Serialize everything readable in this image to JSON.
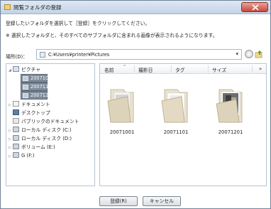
{
  "window": {
    "title": "閲覧フォルダの登録",
    "icon": "folder-icon"
  },
  "instructions": {
    "line1": "登録したいフォルダを選択して［登録］をクリックしてください。",
    "line2": "※ 選択したフォルダと、そのすべてのサブフォルダに含まれる画像が表示されるようになります。"
  },
  "location": {
    "label": "場所(D)：",
    "path": "C:¥Users¥printer¥Pictures"
  },
  "tree": {
    "items": [
      {
        "label": "ピクチャ",
        "icon": "pictures-folder-icon",
        "expander": "◢"
      },
      {
        "label": "20071001",
        "icon": "folder-icon",
        "selected": true
      },
      {
        "label": "20071101",
        "icon": "folder-icon",
        "selected": true
      },
      {
        "label": "20071201",
        "icon": "folder-icon",
        "selected": true
      },
      {
        "label": "ドキュメント",
        "icon": "documents-icon",
        "expander": "▷"
      },
      {
        "label": "デスクトップ",
        "icon": "desktop-icon"
      },
      {
        "label": "パブリックのドキュメント",
        "icon": "public-documents-icon"
      },
      {
        "label": "ローカル ディスク (C:)",
        "icon": "drive-icon",
        "expander": "▷"
      },
      {
        "label": "ローカル ディスク (D:)",
        "icon": "drive-icon",
        "expander": "▷"
      },
      {
        "label": "ボリューム (E:)",
        "icon": "drive-icon",
        "expander": "▷"
      },
      {
        "label": "G (F:)",
        "icon": "drive-icon",
        "expander": "▷"
      }
    ]
  },
  "files": {
    "columns": [
      "名前",
      "撮影日",
      "タグ",
      "サイズ"
    ],
    "more": "»",
    "sort_indicator": "^",
    "folders": [
      {
        "name": "20071001"
      },
      {
        "name": "20071101"
      },
      {
        "name": "20071201"
      }
    ]
  },
  "buttons": {
    "register": "登録(R)",
    "cancel": "キャンセル"
  },
  "colors": {
    "selection": "#7d8a99",
    "folder": "#e6dcc4",
    "accent": "#c7483b"
  }
}
